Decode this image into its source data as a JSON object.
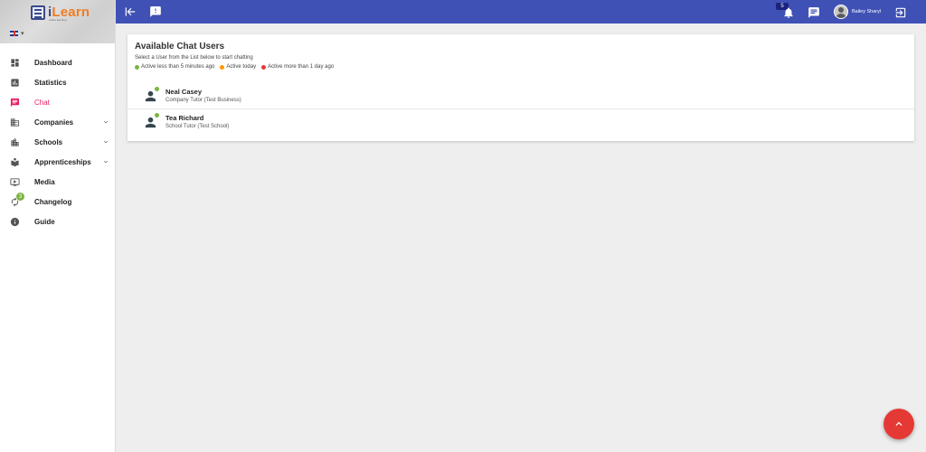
{
  "brand": {
    "logo_text_i": "i",
    "logo_text": "Learn",
    "logo_sub": "online learning"
  },
  "language": {
    "flag": "uk-flag-icon"
  },
  "sidebar": {
    "items": [
      {
        "label": "Dashboard",
        "icon": "dashboard-icon",
        "active": false
      },
      {
        "label": "Statistics",
        "icon": "statistics-icon",
        "active": false
      },
      {
        "label": "Chat",
        "icon": "chat-icon",
        "active": true
      },
      {
        "label": "Companies",
        "icon": "companies-icon",
        "active": false,
        "expandable": true
      },
      {
        "label": "Schools",
        "icon": "schools-icon",
        "active": false,
        "expandable": true
      },
      {
        "label": "Apprenticeships",
        "icon": "apprenticeships-icon",
        "active": false,
        "expandable": true
      },
      {
        "label": "Media",
        "icon": "media-icon",
        "active": false
      },
      {
        "label": "Changelog",
        "icon": "changelog-icon",
        "active": false,
        "badge": "3"
      },
      {
        "label": "Guide",
        "icon": "guide-icon",
        "active": false
      }
    ]
  },
  "topbar": {
    "notification_count": "5",
    "user_name": "Bailey Sharyl"
  },
  "card": {
    "title": "Available Chat Users",
    "subtitle": "Select a User from the List below to start chatting",
    "legend": [
      {
        "label": "Active less than 5 minutes ago",
        "color": "#7cb342"
      },
      {
        "label": "Active today",
        "color": "#ff9800"
      },
      {
        "label": "Active more than 1 day ago",
        "color": "#e53935"
      }
    ],
    "users": [
      {
        "name": "Neal Casey",
        "role": "Company Tutor (Test Business)",
        "status_color": "#7cb342"
      },
      {
        "name": "Tea Richard",
        "role": "School Tutor (Test School)",
        "status_color": "#7cb342"
      }
    ]
  },
  "colors": {
    "primary": "#3f51b5",
    "accent": "#e91e63",
    "fab": "#e53935"
  }
}
